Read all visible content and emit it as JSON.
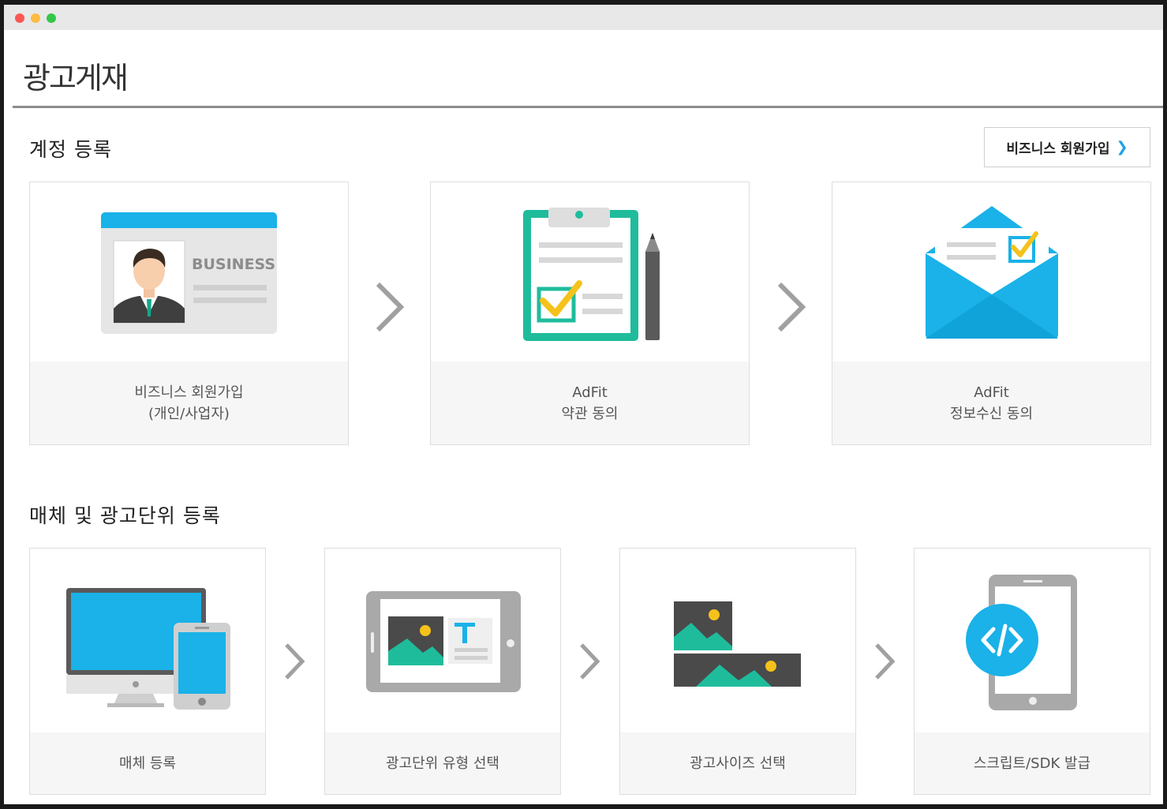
{
  "window": {
    "traffic_lights": [
      "close",
      "minimize",
      "zoom"
    ]
  },
  "page": {
    "title": "광고게재"
  },
  "account_section": {
    "title": "계정 등록",
    "signup_button": {
      "label": "비즈니스 회원가입",
      "icon": "chevron-right-icon",
      "icon_color": "#1aa3e8"
    },
    "steps": [
      {
        "icon": "business-card-icon",
        "line1": "비즈니스 회원가입",
        "line2": "(개인/사업자)",
        "card_text": "BUSINESS"
      },
      {
        "icon": "clipboard-check-icon",
        "line1": "AdFit",
        "line2": "약관 동의"
      },
      {
        "icon": "envelope-check-icon",
        "line1": "AdFit",
        "line2": "정보수신 동의"
      }
    ]
  },
  "media_section": {
    "title": "매체 및 광고단위 등록",
    "steps": [
      {
        "icon": "devices-icon",
        "label": "매체 등록"
      },
      {
        "icon": "tablet-ad-unit-icon",
        "label": "광고단위 유형 선택"
      },
      {
        "icon": "ad-size-images-icon",
        "label": "광고사이즈 선택"
      },
      {
        "icon": "phone-code-icon",
        "label": "스크립트/SDK 발급"
      }
    ]
  },
  "colors": {
    "accent_blue": "#1ab2e8",
    "teal": "#1fbc9c",
    "gold": "#f5c21b",
    "step_arrow": "#a0a0a0"
  }
}
